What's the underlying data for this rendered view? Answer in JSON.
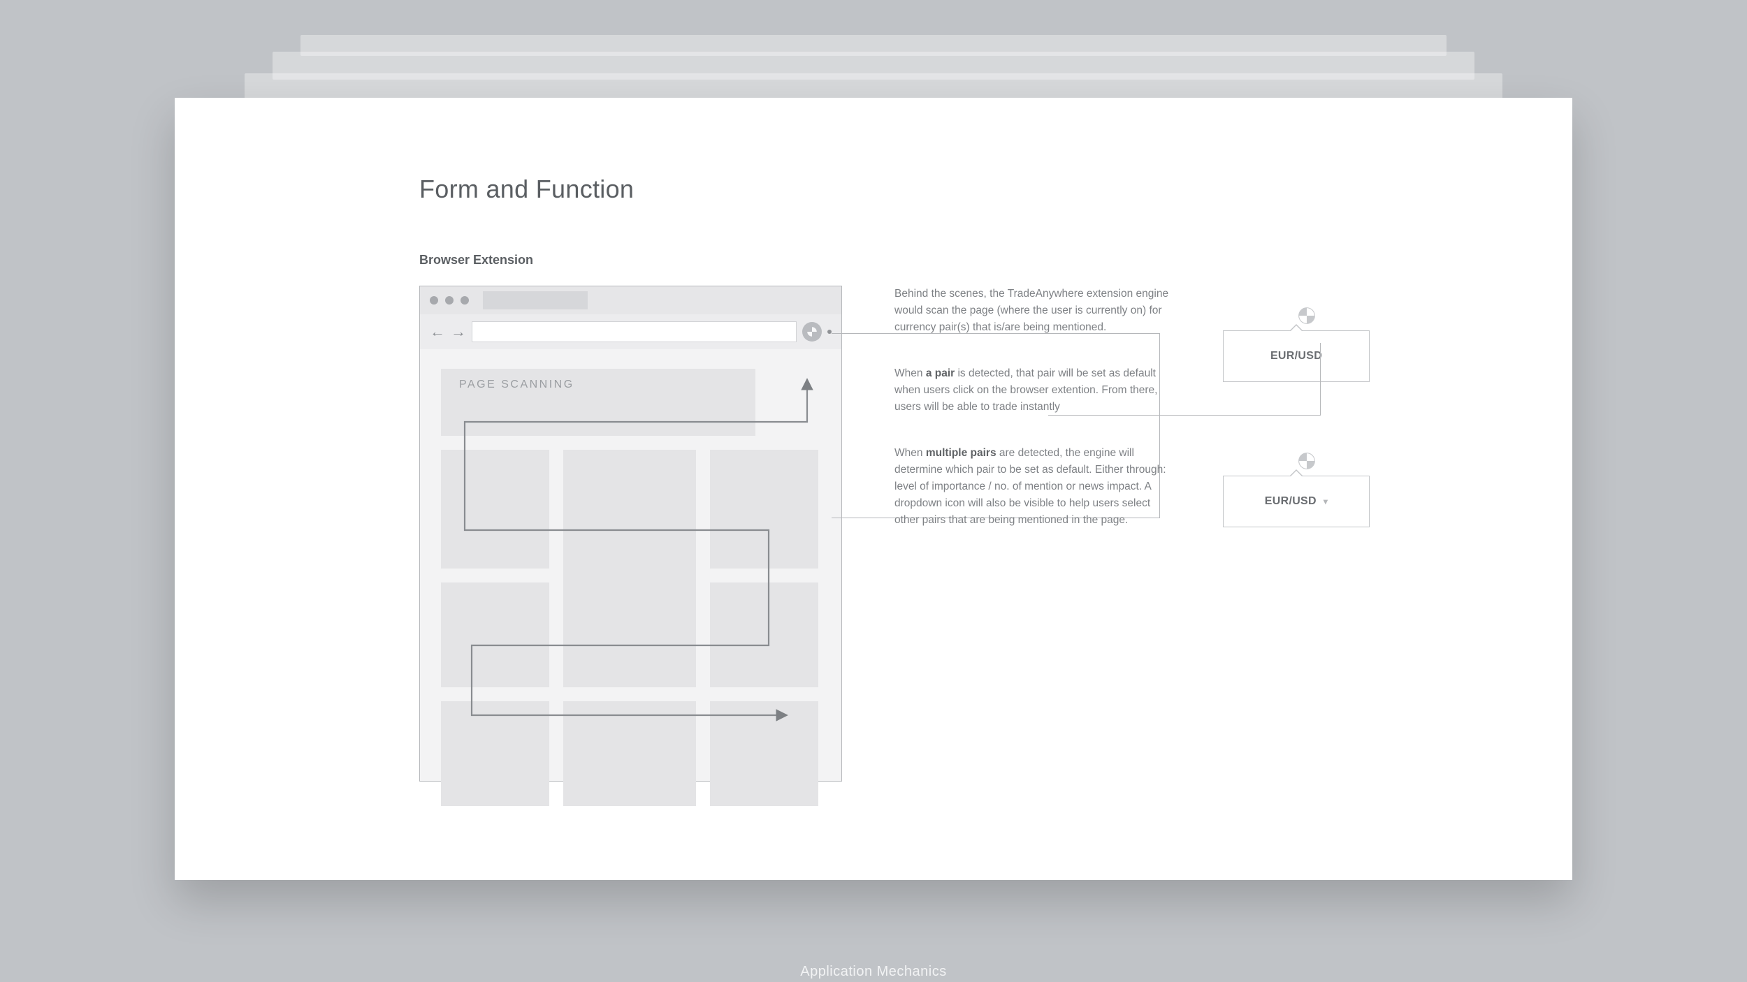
{
  "title": "Form and Function",
  "subtitle": "Browser Extension",
  "caption": "Application Mechanics",
  "browser": {
    "scan_label": "PAGE SCANNING"
  },
  "explain": {
    "p1": "Behind the scenes, the TradeAnywhere extension engine would scan the page (where the user is currently on) for currency pair(s) that is/are being mentioned.",
    "p2_prefix": "When ",
    "p2_bold": "a pair",
    "p2_rest": " is detected, that pair will be set as default when users click on the browser extention. From there, users will be able to trade instantly",
    "p3_prefix": "When ",
    "p3_bold": "multiple pairs",
    "p3_rest": " are detected, the engine will determine which pair to be set as default. Either through: level of importance / no. of mention or news impact. A dropdown icon will also be visible to help users select other pairs that are being mentioned in the page."
  },
  "popups": {
    "single_pair": "EUR/USD",
    "multi_pair": "EUR/USD"
  }
}
